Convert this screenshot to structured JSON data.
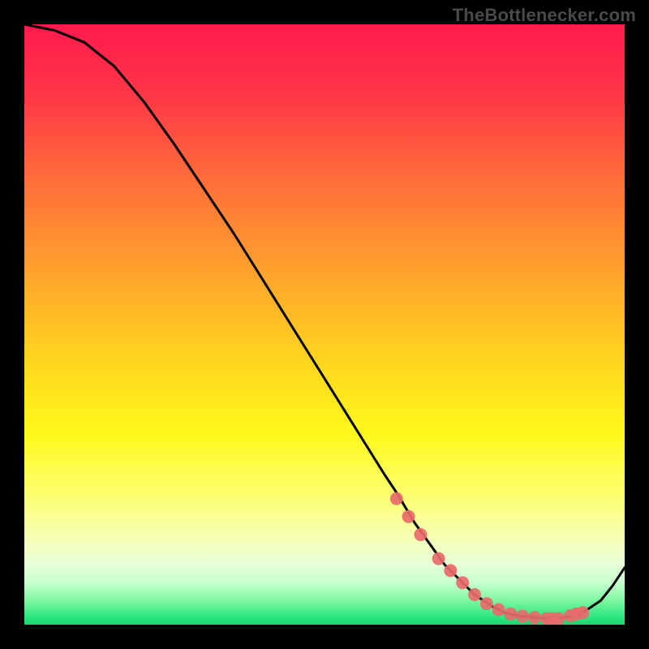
{
  "watermark": "TheBottlenecker.com",
  "chart_data": {
    "type": "line",
    "title": "",
    "xlabel": "",
    "ylabel": "",
    "xlim": [
      0,
      100
    ],
    "ylim": [
      0,
      100
    ],
    "x": [
      0,
      5,
      10,
      15,
      20,
      25,
      30,
      35,
      40,
      45,
      50,
      55,
      60,
      62,
      65,
      70,
      75,
      78,
      80,
      82,
      85,
      88,
      90,
      93,
      96,
      98,
      100
    ],
    "values": [
      100,
      99,
      97,
      93,
      87,
      80,
      72.5,
      65,
      57,
      49,
      41,
      33,
      25,
      22,
      17,
      10,
      5,
      3,
      2,
      1.5,
      1.2,
      1.0,
      1.2,
      2.0,
      4.0,
      6.5,
      9.5
    ],
    "markers": {
      "x": [
        62,
        64,
        66,
        69,
        71,
        73,
        75,
        77,
        79,
        81,
        83,
        85,
        87,
        88,
        89,
        91,
        92,
        93
      ],
      "values": [
        21,
        18,
        15,
        11,
        9,
        7,
        5,
        3.5,
        2.5,
        1.8,
        1.4,
        1.2,
        1.0,
        1.0,
        1.0,
        1.5,
        1.8,
        2.0
      ]
    },
    "gradient_stops": [
      {
        "offset": 0.0,
        "color": "#ff1a4d"
      },
      {
        "offset": 0.12,
        "color": "#ff3747"
      },
      {
        "offset": 0.25,
        "color": "#ff6a3a"
      },
      {
        "offset": 0.4,
        "color": "#ff9e2e"
      },
      {
        "offset": 0.55,
        "color": "#ffd21f"
      },
      {
        "offset": 0.68,
        "color": "#fff81a"
      },
      {
        "offset": 0.78,
        "color": "#fdff6c"
      },
      {
        "offset": 0.85,
        "color": "#f7ffb0"
      },
      {
        "offset": 0.9,
        "color": "#e6ffd6"
      },
      {
        "offset": 0.93,
        "color": "#c8ffd0"
      },
      {
        "offset": 0.96,
        "color": "#7cf7a0"
      },
      {
        "offset": 0.985,
        "color": "#34e882"
      },
      {
        "offset": 1.0,
        "color": "#18d66a"
      }
    ],
    "marker_color": "#e86a6a",
    "line_color": "#000000"
  }
}
